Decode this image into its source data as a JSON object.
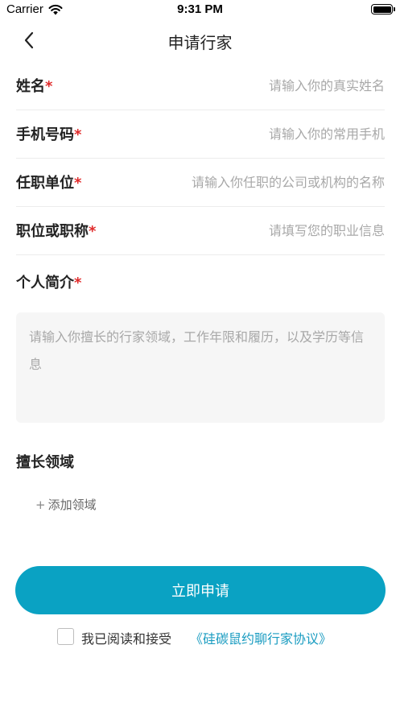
{
  "status_bar": {
    "carrier": "Carrier",
    "time": "9:31 PM"
  },
  "nav": {
    "title": "申请行家"
  },
  "form": {
    "name": {
      "label": "姓名",
      "required_mark": "*",
      "placeholder": "请输入你的真实姓名",
      "value": ""
    },
    "phone": {
      "label": "手机号码",
      "required_mark": "*",
      "placeholder": "请输入你的常用手机",
      "value": ""
    },
    "company": {
      "label": "任职单位",
      "required_mark": "*",
      "placeholder": "请输入你任职的公司或机构的名称",
      "value": ""
    },
    "position": {
      "label": "职位或职称",
      "required_mark": "*",
      "placeholder": "请填写您的职业信息",
      "value": ""
    },
    "intro": {
      "label": "个人简介",
      "required_mark": "*",
      "placeholder": "请输入你擅长的行家领域，工作年限和履历，以及学历等信息",
      "value": ""
    },
    "expertise": {
      "label": "擅长领域",
      "add_label": "添加领域"
    }
  },
  "submit_label": "立即申请",
  "agreement": {
    "checked": false,
    "text": "我已阅读和接受",
    "link": "《硅碳鼠约聊行家协议》"
  },
  "colors": {
    "accent": "#0aa2c3",
    "link": "#1a9cc1",
    "required": "#e02b2b",
    "placeholder": "#a8a8a8"
  },
  "icons": {
    "back": "chevron-left-icon",
    "wifi": "wifi-icon",
    "battery": "battery-icon",
    "add": "plus-icon"
  }
}
